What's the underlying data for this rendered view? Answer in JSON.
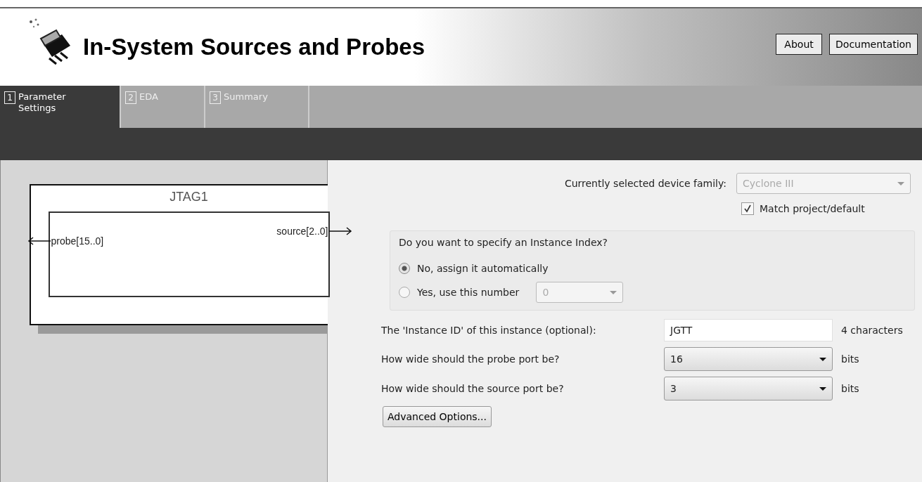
{
  "header": {
    "title": "In-System Sources and Probes",
    "buttons": [
      "About",
      "Documentation"
    ]
  },
  "tabs": [
    {
      "number": "1",
      "label": "Parameter Settings",
      "selected": true
    },
    {
      "number": "2",
      "label": "EDA",
      "selected": false
    },
    {
      "number": "3",
      "label": "Summary",
      "selected": false
    }
  ],
  "diagram": {
    "title": "JTAG1",
    "ports": [
      {
        "label": "probe[15..0]",
        "kind": "output_left"
      },
      {
        "label": "source[2..0]",
        "kind": "output_right"
      }
    ]
  },
  "device_family": {
    "label": "Currently selected device family:",
    "value": "Cyclone III",
    "disabled": true,
    "match": {
      "label": "Match project/default",
      "checked": true
    }
  },
  "instance_index": {
    "title": "Do you want to specify an Instance Index?",
    "options": [
      {
        "label": "No, assign it automatically",
        "selected": true
      },
      {
        "label": "Yes, use this number",
        "selected": false
      }
    ],
    "number": {
      "value": "0",
      "disabled": true
    }
  },
  "fields": [
    {
      "kind": "text",
      "label": "The 'Instance ID' of this instance (optional):",
      "value": "JGTT",
      "unit": "4 characters"
    },
    {
      "kind": "select",
      "label": "How wide should the probe port be?",
      "value": "16",
      "unit": "bits"
    },
    {
      "kind": "select",
      "label": "How wide should the source port be?",
      "value": "3",
      "unit": "bits"
    }
  ],
  "advanced_button": "Advanced Options..."
}
